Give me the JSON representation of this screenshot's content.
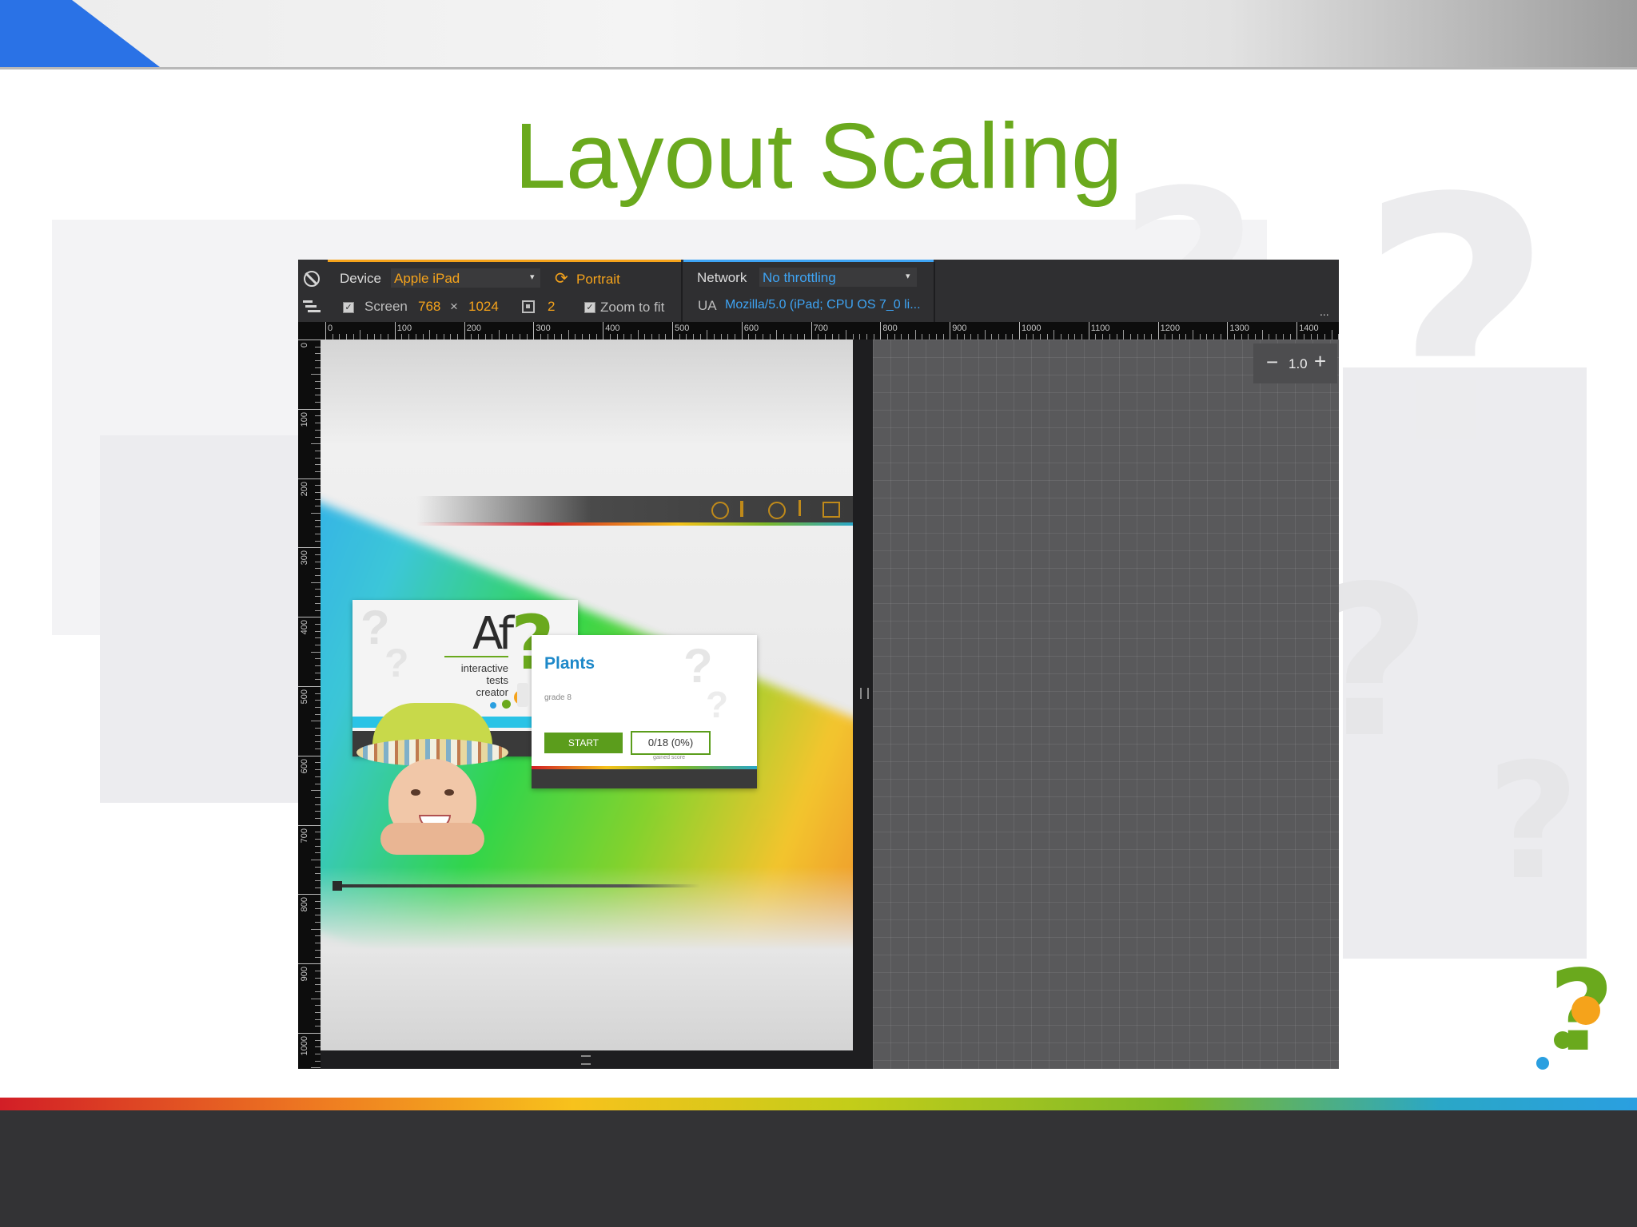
{
  "slide": {
    "title": "Layout Scaling"
  },
  "devtools": {
    "device_label": "Device",
    "device_value": "Apple iPad",
    "orientation_label": "Portrait",
    "network_label": "Network",
    "network_value": "No throttling",
    "screen_label": "Screen",
    "screen_width": "768",
    "screen_times": "×",
    "screen_height": "1024",
    "pixel_ratio": "2",
    "zoom_to_fit_label": "Zoom to fit",
    "ua_label": "UA",
    "ua_value": "Mozilla/5.0 (iPad; CPU OS 7_0 li...",
    "more_label": "...",
    "zoom_value": "1.0",
    "zoom_minus": "−",
    "zoom_plus": "+",
    "ruler_x": [
      "0",
      "100",
      "200",
      "300",
      "400",
      "500",
      "600",
      "700",
      "800",
      "900",
      "1000",
      "1100",
      "1200",
      "1300",
      "1400"
    ],
    "ruler_y": [
      "0",
      "100",
      "200",
      "300",
      "400",
      "500",
      "600",
      "700",
      "800",
      "900",
      "1000"
    ]
  },
  "app": {
    "logo_text": "Af",
    "logo_line1": "interactive",
    "logo_line2": "tests",
    "logo_line3": "creator",
    "test_title": "Plants",
    "test_subtitle": "grade 8",
    "start_label": "START",
    "score_value": "0/18 (0%)",
    "score_caption": "gained score"
  },
  "colors": {
    "title_green": "#6aa91d",
    "accent_orange": "#f5a31b",
    "accent_blue": "#3ea4f4",
    "app_green": "#5b9d1c",
    "plants_blue": "#1d88c9"
  }
}
